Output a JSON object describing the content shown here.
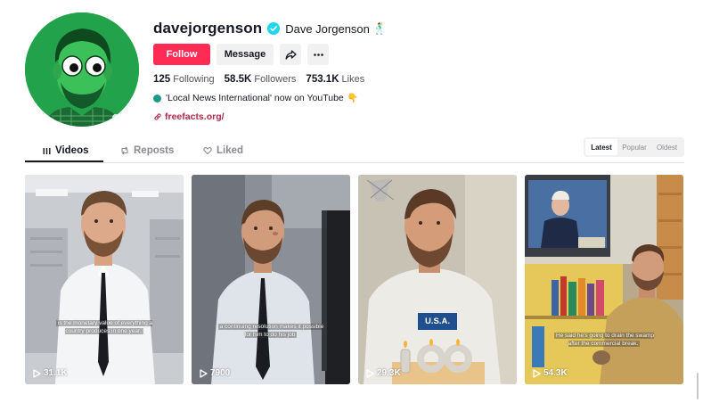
{
  "profile": {
    "username": "davejorgenson",
    "display_name": "Dave Jorgenson",
    "verified": true,
    "follow_label": "Follow",
    "message_label": "Message",
    "stats": {
      "following_count": "125",
      "following_label": "Following",
      "followers_count": "58.5K",
      "followers_label": "Followers",
      "likes_count": "753.1K",
      "likes_label": "Likes"
    },
    "bio": "'Local News International' now on YouTube",
    "link": "freefacts.org/"
  },
  "tabs": [
    {
      "label": "Videos",
      "active": true
    },
    {
      "label": "Reposts",
      "active": false
    },
    {
      "label": "Liked",
      "active": false
    }
  ],
  "sort": {
    "options": [
      "Latest",
      "Popular",
      "Oldest"
    ],
    "selected": "Latest"
  },
  "videos": [
    {
      "views": "31.1K",
      "caption": "is the monetary value of everything a country produces in one year."
    },
    {
      "views": "7900",
      "caption": "a continuing resolution makes it possible for him to do his job"
    },
    {
      "views": "29.3K",
      "caption": "",
      "badge": "U.S.A."
    },
    {
      "views": "54.3K",
      "caption": "He said he's going to drain the swamp after the commercial break."
    }
  ],
  "colors": {
    "accent": "#fe2c55",
    "link": "#ad2a4b",
    "verified": "#20d5ec",
    "avatar_bg": "#22a24a"
  }
}
